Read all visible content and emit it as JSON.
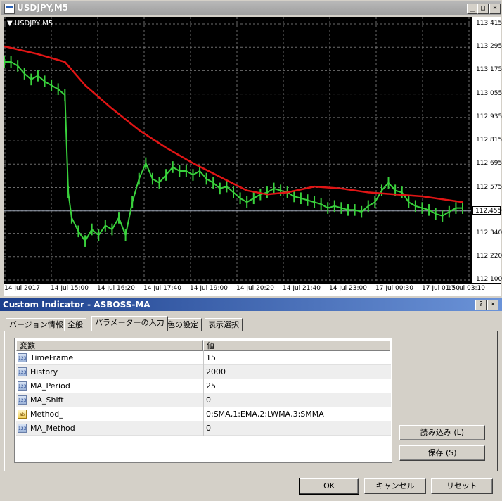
{
  "chart_window": {
    "title": "USDJPY,M5",
    "symbol_label": "USDJPY,M5",
    "buttons": {
      "minimize": "_",
      "restore": "□",
      "close": "×"
    },
    "current_price": "112.455"
  },
  "chart_data": {
    "type": "line",
    "title": "USDJPY,M5",
    "xlabel": "",
    "ylabel": "",
    "ylim": [
      112.1,
      113.415
    ],
    "price_ticks": [
      "113.415",
      "113.295",
      "113.175",
      "113.055",
      "112.935",
      "112.815",
      "112.695",
      "112.575",
      "112.455",
      "112.340",
      "112.220",
      "112.100"
    ],
    "time_ticks": [
      "14 Jul 2017",
      "14 Jul 15:00",
      "14 Jul 16:20",
      "14 Jul 17:40",
      "14 Jul 19:00",
      "14 Jul 20:20",
      "14 Jul 21:40",
      "14 Jul 23:00",
      "17 Jul 00:30",
      "17 Jul 01:50",
      "17 Jul 03:10"
    ],
    "grid": true,
    "background": "#000000",
    "series": [
      {
        "color": "#39d13c",
        "points": [
          [
            0,
            113.22
          ],
          [
            2,
            113.22
          ],
          [
            4,
            113.2
          ],
          [
            6,
            113.16
          ],
          [
            8,
            113.13
          ],
          [
            10,
            113.15
          ],
          [
            12,
            113.12
          ],
          [
            14,
            113.1
          ],
          [
            16,
            113.08
          ],
          [
            18,
            113.05
          ],
          [
            19,
            112.55
          ],
          [
            20,
            112.42
          ],
          [
            22,
            112.35
          ],
          [
            24,
            112.3
          ],
          [
            26,
            112.36
          ],
          [
            28,
            112.33
          ],
          [
            30,
            112.38
          ],
          [
            32,
            112.36
          ],
          [
            34,
            112.42
          ],
          [
            36,
            112.33
          ],
          [
            38,
            112.5
          ],
          [
            40,
            112.62
          ],
          [
            42,
            112.7
          ],
          [
            44,
            112.62
          ],
          [
            46,
            112.6
          ],
          [
            48,
            112.64
          ],
          [
            50,
            112.68
          ],
          [
            52,
            112.66
          ],
          [
            54,
            112.66
          ],
          [
            56,
            112.64
          ],
          [
            58,
            112.66
          ],
          [
            60,
            112.62
          ],
          [
            62,
            112.6
          ],
          [
            64,
            112.57
          ],
          [
            66,
            112.58
          ],
          [
            68,
            112.55
          ],
          [
            70,
            112.52
          ],
          [
            72,
            112.5
          ],
          [
            74,
            112.52
          ],
          [
            76,
            112.54
          ],
          [
            78,
            112.55
          ],
          [
            80,
            112.57
          ],
          [
            82,
            112.56
          ],
          [
            84,
            112.55
          ],
          [
            86,
            112.53
          ],
          [
            88,
            112.52
          ],
          [
            90,
            112.51
          ],
          [
            92,
            112.5
          ],
          [
            94,
            112.49
          ],
          [
            96,
            112.47
          ],
          [
            98,
            112.48
          ],
          [
            100,
            112.47
          ],
          [
            102,
            112.46
          ],
          [
            104,
            112.46
          ],
          [
            106,
            112.45
          ],
          [
            108,
            112.48
          ],
          [
            110,
            112.5
          ],
          [
            112,
            112.56
          ],
          [
            114,
            112.6
          ],
          [
            116,
            112.56
          ],
          [
            118,
            112.55
          ],
          [
            120,
            112.5
          ],
          [
            122,
            112.48
          ],
          [
            124,
            112.47
          ],
          [
            126,
            112.46
          ],
          [
            128,
            112.44
          ],
          [
            130,
            112.43
          ],
          [
            132,
            112.45
          ],
          [
            134,
            112.47
          ],
          [
            136,
            112.47
          ]
        ]
      },
      {
        "color": "#e01515",
        "points": [
          [
            0,
            113.3
          ],
          [
            10,
            113.26
          ],
          [
            18,
            113.22
          ],
          [
            24,
            113.1
          ],
          [
            32,
            112.98
          ],
          [
            40,
            112.87
          ],
          [
            48,
            112.78
          ],
          [
            56,
            112.7
          ],
          [
            64,
            112.63
          ],
          [
            72,
            112.56
          ],
          [
            78,
            112.54
          ],
          [
            84,
            112.55
          ],
          [
            92,
            112.58
          ],
          [
            100,
            112.57
          ],
          [
            108,
            112.55
          ],
          [
            116,
            112.54
          ],
          [
            124,
            112.53
          ],
          [
            132,
            112.51
          ],
          [
            136,
            112.5
          ]
        ]
      }
    ]
  },
  "dialog": {
    "title": "Custom Indicator - ASBOSS-MA",
    "buttons": {
      "help": "?",
      "close": "×"
    },
    "tabs": [
      {
        "label": "バージョン情報"
      },
      {
        "label": "全般"
      },
      {
        "label": "パラメーターの入力"
      },
      {
        "label": "色の設定"
      },
      {
        "label": "表示選択"
      }
    ],
    "grid": {
      "col_variable": "変数",
      "col_value": "値",
      "rows": [
        {
          "icon": "123",
          "name": "TimeFrame",
          "value": "15"
        },
        {
          "icon": "123",
          "name": "History",
          "value": "2000"
        },
        {
          "icon": "123",
          "name": "MA_Period",
          "value": "25"
        },
        {
          "icon": "123",
          "name": "MA_Shift",
          "value": "0"
        },
        {
          "icon": "ab",
          "name": "Method_",
          "value": "0:SMA,1:EMA,2:LWMA,3:SMMA"
        },
        {
          "icon": "123",
          "name": "MA_Method",
          "value": "0"
        }
      ]
    },
    "load_button": "読み込み (L)",
    "save_button": "保存 (S)",
    "ok_button": "OK",
    "cancel_button": "キャンセル",
    "reset_button": "リセット"
  }
}
